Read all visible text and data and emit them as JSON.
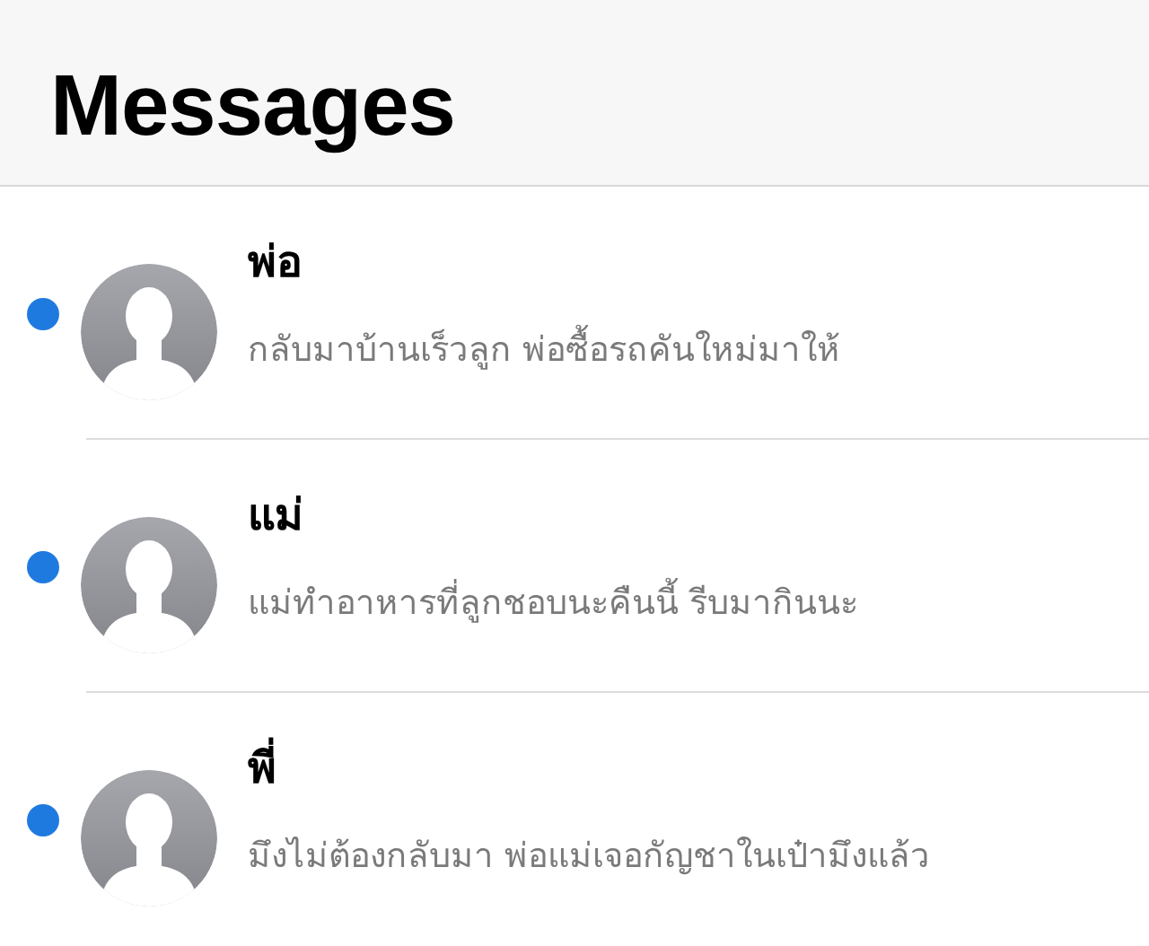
{
  "header": {
    "title": "Messages"
  },
  "conversations": [
    {
      "name": "พ่อ",
      "preview": "กลับมาบ้านเร็วลูก พ่อซื้อรถคันใหม่มาให้",
      "unread": true
    },
    {
      "name": "แม่",
      "preview": "แม่ทำอาหารที่ลูกชอบนะคืนนี้ รีบมากินนะ",
      "unread": true
    },
    {
      "name": "พี่",
      "preview": "มึงไม่ต้องกลับมา พ่อแม่เจอกัญชาในเป๋ามึงแล้ว",
      "unread": true
    }
  ]
}
